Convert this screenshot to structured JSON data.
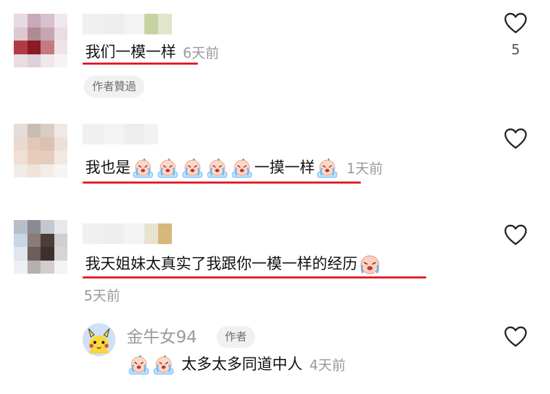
{
  "comments": [
    {
      "text": "我们一模一样",
      "time": "6天前",
      "likes": "5",
      "badge": "作者贊過"
    },
    {
      "text_before": "我也是",
      "text_middle": "一摸一样",
      "time": "1天前"
    },
    {
      "text": "我天姐妹太真实了我跟你一模一样的经历",
      "time": "5天前"
    }
  ],
  "reply": {
    "author": "金牛女94",
    "author_tag": "作者",
    "text": "太多太多同道中人",
    "time": "4天前"
  },
  "icons": {
    "like": "heart-outline-icon",
    "emoji": "crying-face-emoji"
  },
  "colors": {
    "underline": "#e21b2a",
    "muted": "#9a9a9a"
  }
}
